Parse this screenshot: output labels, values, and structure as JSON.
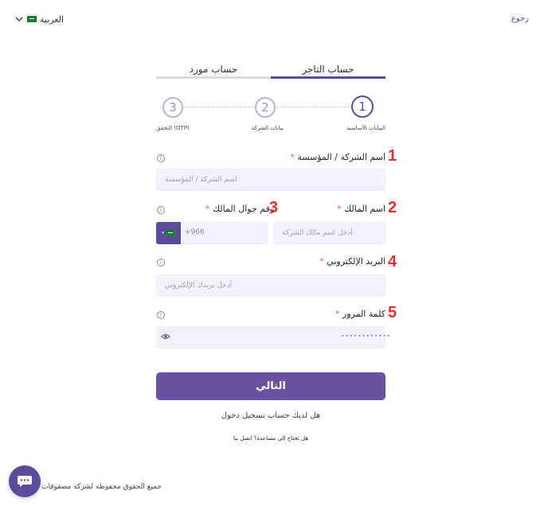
{
  "header": {
    "language_label": "العربية",
    "back_link": "رجوع"
  },
  "tabs": [
    {
      "label": "حساب التاجر",
      "active": true
    },
    {
      "label": "حساب مورد",
      "active": false
    }
  ],
  "stepper": [
    {
      "number": "1",
      "label": "البيانات الأساسية",
      "active": true
    },
    {
      "number": "2",
      "label": "بيانات الشركة",
      "active": false
    },
    {
      "number": "3",
      "label": "التحقق (OTP)",
      "active": false
    }
  ],
  "form": {
    "company_name": {
      "label": "اسم الشركة / المؤسسة",
      "placeholder": "اسم الشركة / المؤسسة",
      "annotation": "1"
    },
    "owner_name": {
      "label": "اسم المالك",
      "placeholder": "أدخل اسم مالك الشركة",
      "annotation": "2"
    },
    "owner_mobile": {
      "label": "رقم جوال المالك",
      "dial_code": "+966",
      "annotation": "3"
    },
    "email": {
      "label": "البريد الإلكتروني",
      "placeholder": "أدخل بريدك الإلكتروني",
      "annotation": "4"
    },
    "password": {
      "label": "كلمة المرور",
      "masked_value": "••••••••••••",
      "annotation": "5"
    },
    "required_mark": "*"
  },
  "actions": {
    "next_button": "التالي",
    "login_prompt": "هل لديك حساب تسجيل دخول",
    "help_text": "هل تحتاج الى مساعدة؟ اتصل بنا"
  },
  "footer": {
    "copyright": "جميع الحقوق محفوظة لشركة مصفوفات"
  },
  "colors": {
    "brand": "#5b4b9a",
    "button": "#6a52a0",
    "annotation": "#e62e2e",
    "input_bg": "#f2f2fa"
  }
}
